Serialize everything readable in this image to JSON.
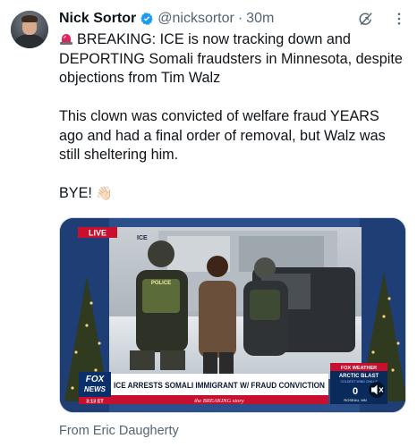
{
  "author": {
    "name": "Nick Sortor",
    "handle": "@nicksortor",
    "separator": "·",
    "time": "30m",
    "verified": true,
    "avatar_icon": "avatar-photo"
  },
  "icons": {
    "verified": "verified-badge-icon",
    "grok": "grok-icon",
    "more": "more-options-icon",
    "siren": "siren-emoji",
    "wave": "waving-hand-emoji"
  },
  "tweet": {
    "line1": "BREAKING: ICE is now tracking down and DEPORTING Somali fraudsters in Minnesota, despite objections from Tim Walz",
    "line2": "This clown was convicted of welfare fraud YEARS ago and had a final order of removal, but Walz was still sheltering him.",
    "line3": "BYE!",
    "wave_emoji": "👋🏻"
  },
  "video": {
    "live_badge": "LIVE",
    "ice_tag": "ICE",
    "police_label": "POLICE",
    "news_logo_top": "FOX",
    "news_logo_bottom": "NEWS",
    "clock": "3:13 ET",
    "headline": "ICE ARRESTS SOMALI IMMIGRANT W/ FRAUD CONVICTION",
    "subline": "the BREAKING story",
    "weather_brand": "FOX WEATHER",
    "weather_alert": "ARCTIC BLAST",
    "weather_sub": "COLDEST WIND CHILLS",
    "weather_temp": "0",
    "weather_city": "ROSEAU, MN",
    "mute_icon": "speaker-mute-icon",
    "colors": {
      "fox_blue": "#0b2f6b",
      "breaking_red": "#c8102e",
      "weather_navy": "#0a2a5c"
    }
  },
  "attribution": "From Eric Daugherty"
}
